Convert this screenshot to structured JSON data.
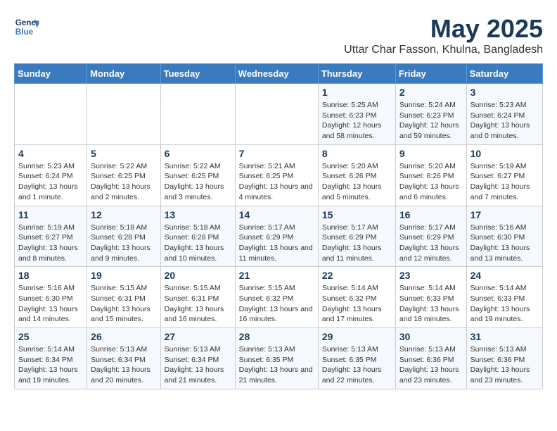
{
  "logo": {
    "line1": "General",
    "line2": "Blue"
  },
  "title": "May 2025",
  "subtitle": "Uttar Char Fasson, Khulna, Bangladesh",
  "days_of_week": [
    "Sunday",
    "Monday",
    "Tuesday",
    "Wednesday",
    "Thursday",
    "Friday",
    "Saturday"
  ],
  "weeks": [
    [
      {
        "day": "",
        "info": ""
      },
      {
        "day": "",
        "info": ""
      },
      {
        "day": "",
        "info": ""
      },
      {
        "day": "",
        "info": ""
      },
      {
        "day": "1",
        "info": "Sunrise: 5:25 AM\nSunset: 6:23 PM\nDaylight: 12 hours and 58 minutes."
      },
      {
        "day": "2",
        "info": "Sunrise: 5:24 AM\nSunset: 6:23 PM\nDaylight: 12 hours and 59 minutes."
      },
      {
        "day": "3",
        "info": "Sunrise: 5:23 AM\nSunset: 6:24 PM\nDaylight: 13 hours and 0 minutes."
      }
    ],
    [
      {
        "day": "4",
        "info": "Sunrise: 5:23 AM\nSunset: 6:24 PM\nDaylight: 13 hours and 1 minute."
      },
      {
        "day": "5",
        "info": "Sunrise: 5:22 AM\nSunset: 6:25 PM\nDaylight: 13 hours and 2 minutes."
      },
      {
        "day": "6",
        "info": "Sunrise: 5:22 AM\nSunset: 6:25 PM\nDaylight: 13 hours and 3 minutes."
      },
      {
        "day": "7",
        "info": "Sunrise: 5:21 AM\nSunset: 6:25 PM\nDaylight: 13 hours and 4 minutes."
      },
      {
        "day": "8",
        "info": "Sunrise: 5:20 AM\nSunset: 6:26 PM\nDaylight: 13 hours and 5 minutes."
      },
      {
        "day": "9",
        "info": "Sunrise: 5:20 AM\nSunset: 6:26 PM\nDaylight: 13 hours and 6 minutes."
      },
      {
        "day": "10",
        "info": "Sunrise: 5:19 AM\nSunset: 6:27 PM\nDaylight: 13 hours and 7 minutes."
      }
    ],
    [
      {
        "day": "11",
        "info": "Sunrise: 5:19 AM\nSunset: 6:27 PM\nDaylight: 13 hours and 8 minutes."
      },
      {
        "day": "12",
        "info": "Sunrise: 5:18 AM\nSunset: 6:28 PM\nDaylight: 13 hours and 9 minutes."
      },
      {
        "day": "13",
        "info": "Sunrise: 5:18 AM\nSunset: 6:28 PM\nDaylight: 13 hours and 10 minutes."
      },
      {
        "day": "14",
        "info": "Sunrise: 5:17 AM\nSunset: 6:29 PM\nDaylight: 13 hours and 11 minutes."
      },
      {
        "day": "15",
        "info": "Sunrise: 5:17 AM\nSunset: 6:29 PM\nDaylight: 13 hours and 11 minutes."
      },
      {
        "day": "16",
        "info": "Sunrise: 5:17 AM\nSunset: 6:29 PM\nDaylight: 13 hours and 12 minutes."
      },
      {
        "day": "17",
        "info": "Sunrise: 5:16 AM\nSunset: 6:30 PM\nDaylight: 13 hours and 13 minutes."
      }
    ],
    [
      {
        "day": "18",
        "info": "Sunrise: 5:16 AM\nSunset: 6:30 PM\nDaylight: 13 hours and 14 minutes."
      },
      {
        "day": "19",
        "info": "Sunrise: 5:15 AM\nSunset: 6:31 PM\nDaylight: 13 hours and 15 minutes."
      },
      {
        "day": "20",
        "info": "Sunrise: 5:15 AM\nSunset: 6:31 PM\nDaylight: 13 hours and 16 minutes."
      },
      {
        "day": "21",
        "info": "Sunrise: 5:15 AM\nSunset: 6:32 PM\nDaylight: 13 hours and 16 minutes."
      },
      {
        "day": "22",
        "info": "Sunrise: 5:14 AM\nSunset: 6:32 PM\nDaylight: 13 hours and 17 minutes."
      },
      {
        "day": "23",
        "info": "Sunrise: 5:14 AM\nSunset: 6:33 PM\nDaylight: 13 hours and 18 minutes."
      },
      {
        "day": "24",
        "info": "Sunrise: 5:14 AM\nSunset: 6:33 PM\nDaylight: 13 hours and 19 minutes."
      }
    ],
    [
      {
        "day": "25",
        "info": "Sunrise: 5:14 AM\nSunset: 6:34 PM\nDaylight: 13 hours and 19 minutes."
      },
      {
        "day": "26",
        "info": "Sunrise: 5:13 AM\nSunset: 6:34 PM\nDaylight: 13 hours and 20 minutes."
      },
      {
        "day": "27",
        "info": "Sunrise: 5:13 AM\nSunset: 6:34 PM\nDaylight: 13 hours and 21 minutes."
      },
      {
        "day": "28",
        "info": "Sunrise: 5:13 AM\nSunset: 6:35 PM\nDaylight: 13 hours and 21 minutes."
      },
      {
        "day": "29",
        "info": "Sunrise: 5:13 AM\nSunset: 6:35 PM\nDaylight: 13 hours and 22 minutes."
      },
      {
        "day": "30",
        "info": "Sunrise: 5:13 AM\nSunset: 6:36 PM\nDaylight: 13 hours and 23 minutes."
      },
      {
        "day": "31",
        "info": "Sunrise: 5:13 AM\nSunset: 6:36 PM\nDaylight: 13 hours and 23 minutes."
      }
    ]
  ]
}
